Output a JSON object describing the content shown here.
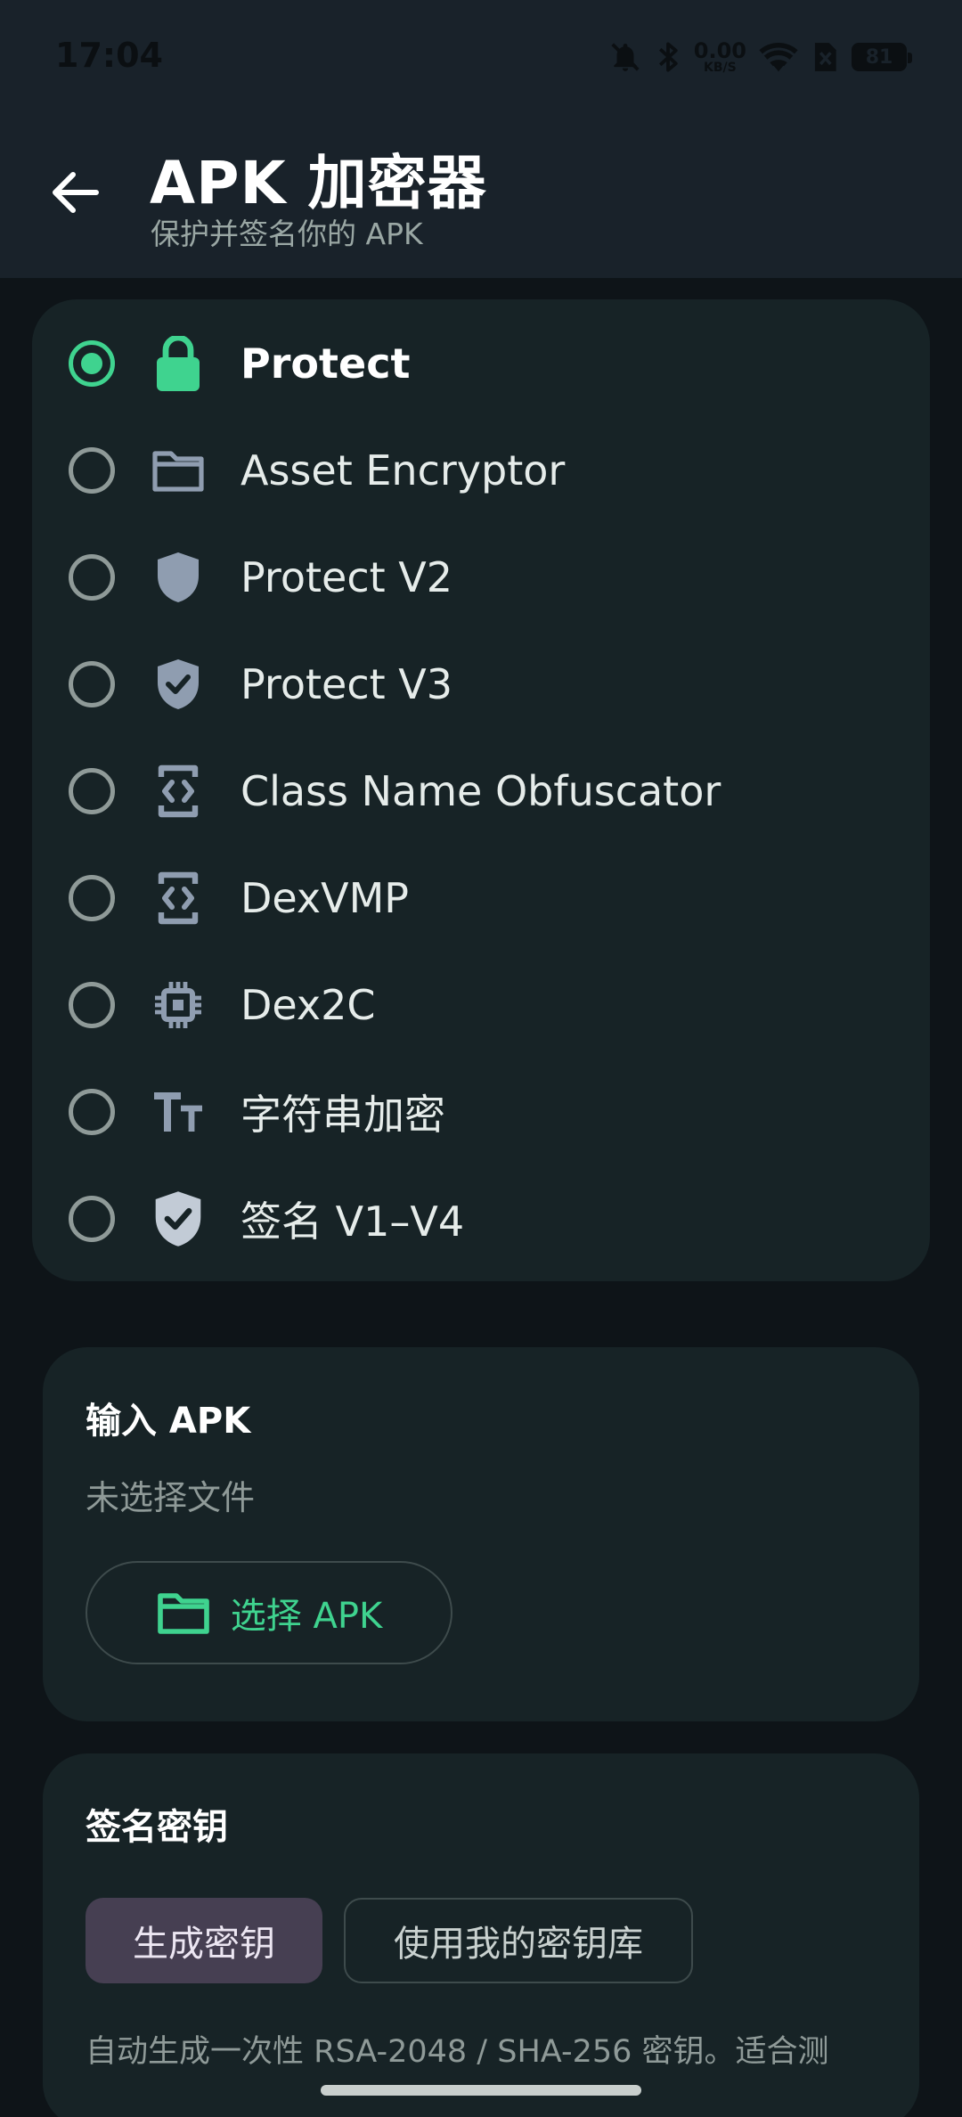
{
  "status_bar": {
    "time": "17:04",
    "net_speed_value": "0.00",
    "net_speed_unit": "KB/S",
    "battery": "81"
  },
  "app_bar": {
    "title": "APK 加密器",
    "subtitle": "保护并签名你的 APK"
  },
  "modes": {
    "selected_index": 0,
    "items": [
      {
        "label": "Protect",
        "icon": "lock-icon"
      },
      {
        "label": "Asset Encryptor",
        "icon": "folder-icon"
      },
      {
        "label": "Protect V2",
        "icon": "shield-icon"
      },
      {
        "label": "Protect V3",
        "icon": "shield-check-icon"
      },
      {
        "label": "Class Name Obfuscator",
        "icon": "code-phone-icon"
      },
      {
        "label": "DexVMP",
        "icon": "code-phone-icon"
      },
      {
        "label": "Dex2C",
        "icon": "chip-icon"
      },
      {
        "label": "字符串加密",
        "icon": "text-size-icon"
      },
      {
        "label": "签名 V1–V4",
        "icon": "shield-check-icon"
      }
    ]
  },
  "input_card": {
    "title": "输入 APK",
    "status": "未选择文件",
    "pick_button": "选择 APK"
  },
  "signing_card": {
    "title": "签名密钥",
    "generate_key": "生成密钥",
    "use_keystore": "使用我的密钥库",
    "description": "自动生成一次性 RSA-2048 / SHA-256 密钥。适合测"
  },
  "colors": {
    "accent": "#3fd38f",
    "card_bg": "#172326",
    "app_bar_bg": "#19222a",
    "page_bg": "#0e1418"
  }
}
